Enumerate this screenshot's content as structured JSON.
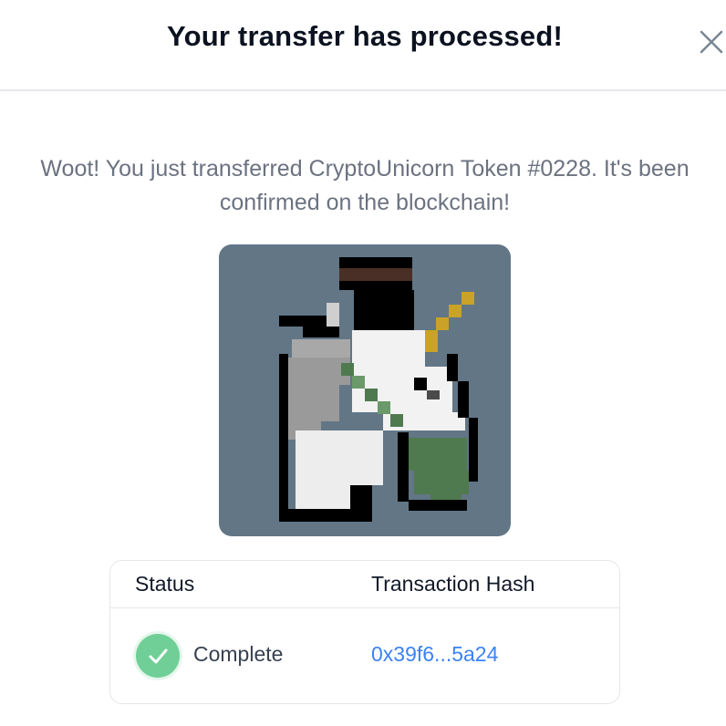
{
  "modal": {
    "title": "Your transfer has processed!",
    "close_icon": "close-icon",
    "message": "Woot! You just transferred CryptoUnicorn Token #0228. It's been confirmed on the blockchain!"
  },
  "nft": {
    "image_icon": "pixel-unicorn-image",
    "background_color": "#627686"
  },
  "transaction_table": {
    "headers": {
      "status": "Status",
      "hash": "Transaction Hash"
    },
    "row": {
      "status_icon": "check-circle-icon",
      "status": "Complete",
      "hash": "0x39f6...5a24"
    }
  },
  "colors": {
    "success": "#6fcf97",
    "link": "#3b82f6",
    "title": "#0b1220",
    "muted_text": "#6b7280"
  }
}
